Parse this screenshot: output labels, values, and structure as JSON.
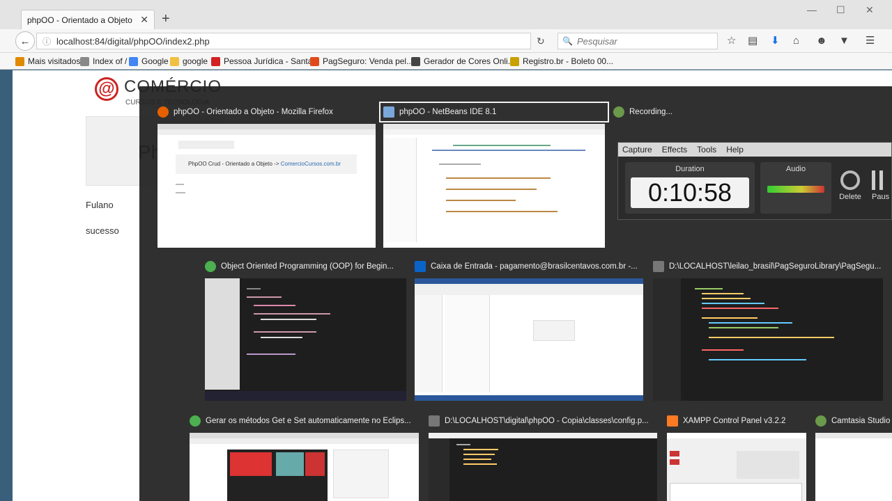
{
  "browser": {
    "tab_title": "phpOO - Orientado a Objeto",
    "tab_close": "✕",
    "new_tab": "+",
    "url_info_icon": "info-icon",
    "url": "localhost:84/digital/phpOO/index2.php",
    "search_placeholder": "Pesquisar",
    "window_controls": [
      "—",
      "☐",
      "✕"
    ],
    "toolbar_icons": [
      "star-icon",
      "bookmarks-list-icon",
      "downloads-icon",
      "home-icon",
      "chat-icon",
      "pocket-icon",
      "menu-icon"
    ],
    "bookmarks": [
      {
        "label": "Mais visitados",
        "color": "#e08a00"
      },
      {
        "label": "Index of /",
        "color": "#888888"
      },
      {
        "label": "Google",
        "color": "#4285f4"
      },
      {
        "label": "google",
        "color": "#f0c040"
      },
      {
        "label": "Pessoa Jurídica - Santa...",
        "color": "#d22222"
      },
      {
        "label": "PagSeguro: Venda pel...",
        "color": "#e04a1a"
      },
      {
        "label": "Gerador de Cores Onli...",
        "color": "#444444"
      },
      {
        "label": "Registro.br - Boleto 00...",
        "color": "#c8a000"
      }
    ]
  },
  "page": {
    "logo_symbol": "@",
    "logo_text": "COMÉRCIO",
    "logo_sub": "CURSOS E TECNOLOGIA",
    "title_fragment": "Ph",
    "lines": [
      "Fulano",
      "sucesso"
    ]
  },
  "switcher": {
    "windows": [
      {
        "title": "phpOO - Orientado a Objeto - Mozilla Firefox",
        "icon": "firefox-icon",
        "color": "#e66000",
        "thumb_text": "PhpOO Crud - Orientado a Objeto -> ",
        "thumb_link": "ComercioCursos.com.br"
      },
      {
        "title": "phpOO - NetBeans IDE 8.1",
        "icon": "netbeans-icon",
        "color": "#7aa7d9"
      },
      {
        "title": "Recording...",
        "icon": "camtasia-recorder-icon",
        "color": "#6a9a4a"
      },
      {
        "title": "Object Oriented Programming (OOP) for Begin...",
        "icon": "chrome-icon",
        "color": "#4caf50"
      },
      {
        "title": "Caixa de Entrada - pagamento@brasilcentavos.com.br -...",
        "icon": "outlook-icon",
        "color": "#0a64c8"
      },
      {
        "title": "D:\\LOCALHOST\\leilao_brasil\\PagSeguroLibrary\\PagSegu...",
        "icon": "sublime-icon",
        "color": "#777777"
      },
      {
        "title": "Gerar os métodos Get e Set automaticamente no Eclips...",
        "icon": "chrome-icon",
        "color": "#4caf50"
      },
      {
        "title": "D:\\LOCALHOST\\digital\\phpOO - Copia\\classes\\config.p...",
        "icon": "sublime-icon",
        "color": "#777777"
      },
      {
        "title": "XAMPP Control Panel v3.2.2",
        "icon": "xampp-icon",
        "color": "#fb7a24"
      },
      {
        "title": "Camtasia Studio",
        "icon": "camtasia-icon",
        "color": "#6a9a4a"
      }
    ]
  },
  "recorder": {
    "menu": [
      "Capture",
      "Effects",
      "Tools",
      "Help"
    ],
    "duration_label": "Duration",
    "duration": "0:10:58",
    "audio_label": "Audio",
    "delete_label": "Delete",
    "pause_label": "Paus"
  }
}
